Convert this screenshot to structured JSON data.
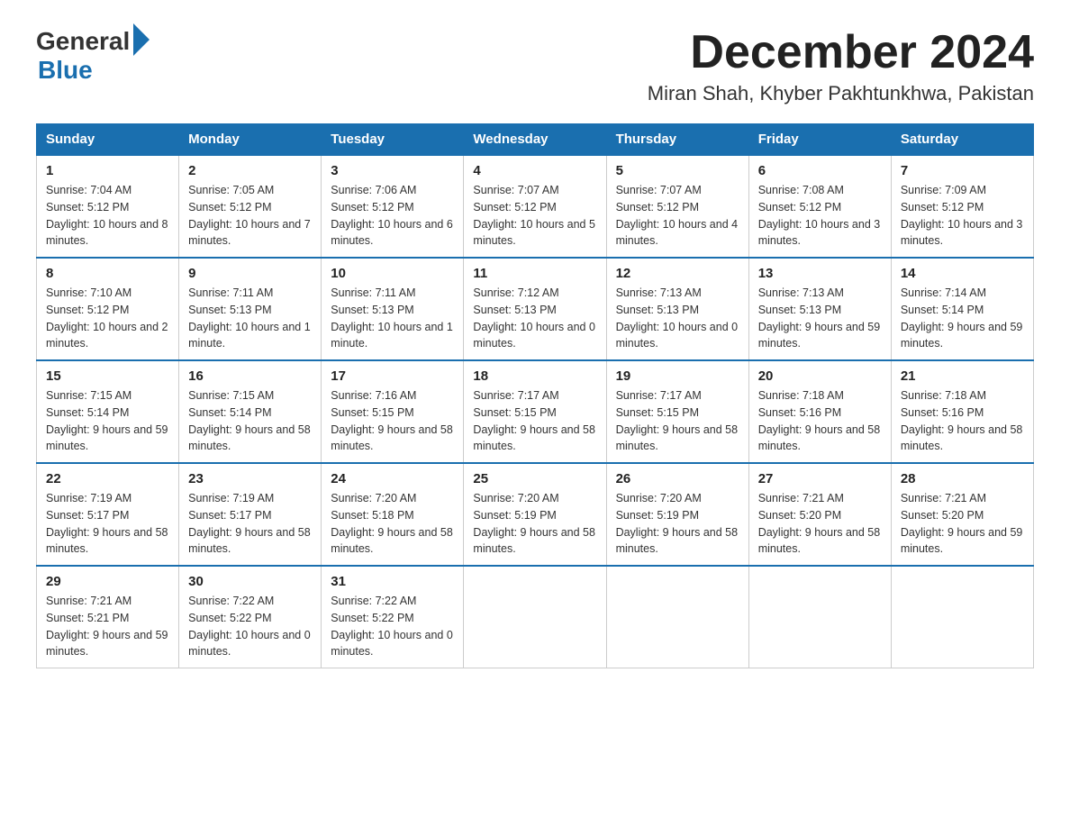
{
  "header": {
    "logo_general": "General",
    "logo_blue": "Blue",
    "month_year": "December 2024",
    "location": "Miran Shah, Khyber Pakhtunkhwa, Pakistan"
  },
  "days_of_week": [
    "Sunday",
    "Monday",
    "Tuesday",
    "Wednesday",
    "Thursday",
    "Friday",
    "Saturday"
  ],
  "weeks": [
    [
      {
        "date": "1",
        "sunrise": "7:04 AM",
        "sunset": "5:12 PM",
        "daylight": "10 hours and 8 minutes."
      },
      {
        "date": "2",
        "sunrise": "7:05 AM",
        "sunset": "5:12 PM",
        "daylight": "10 hours and 7 minutes."
      },
      {
        "date": "3",
        "sunrise": "7:06 AM",
        "sunset": "5:12 PM",
        "daylight": "10 hours and 6 minutes."
      },
      {
        "date": "4",
        "sunrise": "7:07 AM",
        "sunset": "5:12 PM",
        "daylight": "10 hours and 5 minutes."
      },
      {
        "date": "5",
        "sunrise": "7:07 AM",
        "sunset": "5:12 PM",
        "daylight": "10 hours and 4 minutes."
      },
      {
        "date": "6",
        "sunrise": "7:08 AM",
        "sunset": "5:12 PM",
        "daylight": "10 hours and 3 minutes."
      },
      {
        "date": "7",
        "sunrise": "7:09 AM",
        "sunset": "5:12 PM",
        "daylight": "10 hours and 3 minutes."
      }
    ],
    [
      {
        "date": "8",
        "sunrise": "7:10 AM",
        "sunset": "5:12 PM",
        "daylight": "10 hours and 2 minutes."
      },
      {
        "date": "9",
        "sunrise": "7:11 AM",
        "sunset": "5:13 PM",
        "daylight": "10 hours and 1 minute."
      },
      {
        "date": "10",
        "sunrise": "7:11 AM",
        "sunset": "5:13 PM",
        "daylight": "10 hours and 1 minute."
      },
      {
        "date": "11",
        "sunrise": "7:12 AM",
        "sunset": "5:13 PM",
        "daylight": "10 hours and 0 minutes."
      },
      {
        "date": "12",
        "sunrise": "7:13 AM",
        "sunset": "5:13 PM",
        "daylight": "10 hours and 0 minutes."
      },
      {
        "date": "13",
        "sunrise": "7:13 AM",
        "sunset": "5:13 PM",
        "daylight": "9 hours and 59 minutes."
      },
      {
        "date": "14",
        "sunrise": "7:14 AM",
        "sunset": "5:14 PM",
        "daylight": "9 hours and 59 minutes."
      }
    ],
    [
      {
        "date": "15",
        "sunrise": "7:15 AM",
        "sunset": "5:14 PM",
        "daylight": "9 hours and 59 minutes."
      },
      {
        "date": "16",
        "sunrise": "7:15 AM",
        "sunset": "5:14 PM",
        "daylight": "9 hours and 58 minutes."
      },
      {
        "date": "17",
        "sunrise": "7:16 AM",
        "sunset": "5:15 PM",
        "daylight": "9 hours and 58 minutes."
      },
      {
        "date": "18",
        "sunrise": "7:17 AM",
        "sunset": "5:15 PM",
        "daylight": "9 hours and 58 minutes."
      },
      {
        "date": "19",
        "sunrise": "7:17 AM",
        "sunset": "5:15 PM",
        "daylight": "9 hours and 58 minutes."
      },
      {
        "date": "20",
        "sunrise": "7:18 AM",
        "sunset": "5:16 PM",
        "daylight": "9 hours and 58 minutes."
      },
      {
        "date": "21",
        "sunrise": "7:18 AM",
        "sunset": "5:16 PM",
        "daylight": "9 hours and 58 minutes."
      }
    ],
    [
      {
        "date": "22",
        "sunrise": "7:19 AM",
        "sunset": "5:17 PM",
        "daylight": "9 hours and 58 minutes."
      },
      {
        "date": "23",
        "sunrise": "7:19 AM",
        "sunset": "5:17 PM",
        "daylight": "9 hours and 58 minutes."
      },
      {
        "date": "24",
        "sunrise": "7:20 AM",
        "sunset": "5:18 PM",
        "daylight": "9 hours and 58 minutes."
      },
      {
        "date": "25",
        "sunrise": "7:20 AM",
        "sunset": "5:19 PM",
        "daylight": "9 hours and 58 minutes."
      },
      {
        "date": "26",
        "sunrise": "7:20 AM",
        "sunset": "5:19 PM",
        "daylight": "9 hours and 58 minutes."
      },
      {
        "date": "27",
        "sunrise": "7:21 AM",
        "sunset": "5:20 PM",
        "daylight": "9 hours and 58 minutes."
      },
      {
        "date": "28",
        "sunrise": "7:21 AM",
        "sunset": "5:20 PM",
        "daylight": "9 hours and 59 minutes."
      }
    ],
    [
      {
        "date": "29",
        "sunrise": "7:21 AM",
        "sunset": "5:21 PM",
        "daylight": "9 hours and 59 minutes."
      },
      {
        "date": "30",
        "sunrise": "7:22 AM",
        "sunset": "5:22 PM",
        "daylight": "10 hours and 0 minutes."
      },
      {
        "date": "31",
        "sunrise": "7:22 AM",
        "sunset": "5:22 PM",
        "daylight": "10 hours and 0 minutes."
      },
      null,
      null,
      null,
      null
    ]
  ],
  "labels": {
    "sunrise": "Sunrise:",
    "sunset": "Sunset:",
    "daylight": "Daylight:"
  }
}
